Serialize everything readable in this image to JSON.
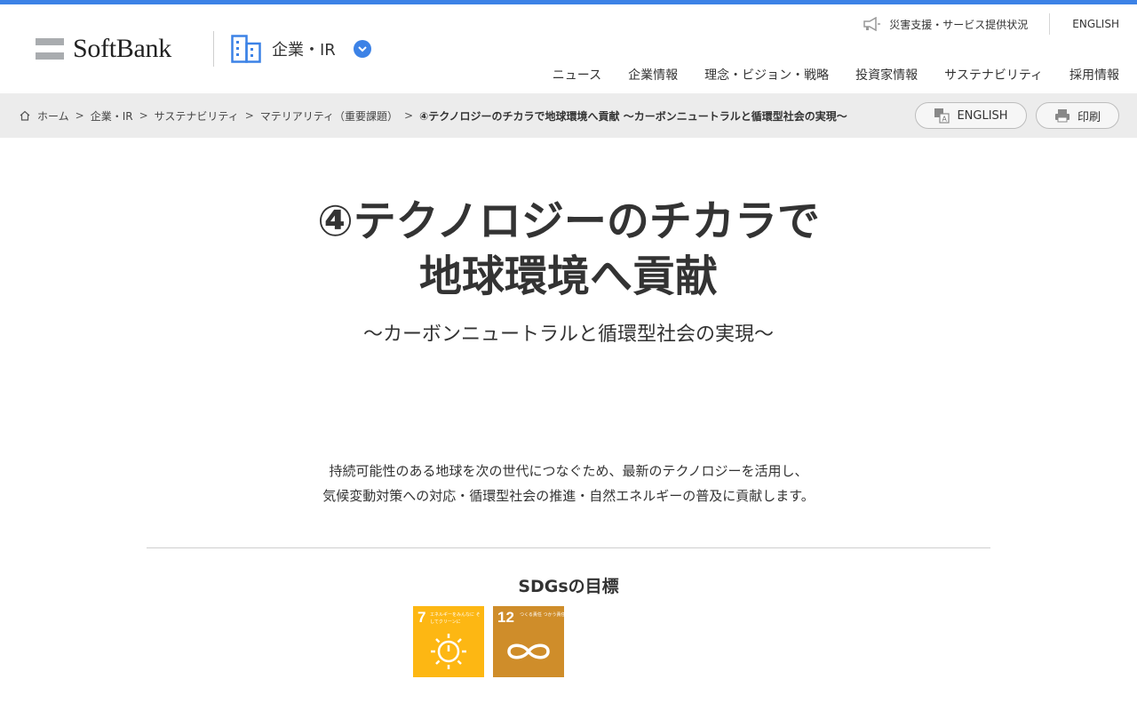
{
  "header": {
    "logo_text": "SoftBank",
    "section_label": "企業・IR",
    "utility_links": {
      "disaster": "災害支援・サービス提供状況",
      "english": "ENGLISH"
    },
    "gnav": [
      "ニュース",
      "企業情報",
      "理念・ビジョン・戦略",
      "投資家情報",
      "サステナビリティ",
      "採用情報"
    ]
  },
  "breadcrumb": {
    "items": [
      "ホーム",
      "企業・IR",
      "サステナビリティ",
      "マテリアリティ（重要課題）"
    ],
    "current": "④テクノロジーのチカラで地球環境へ貢献 〜カーボンニュートラルと循環型社会の実現〜"
  },
  "actions": {
    "english": "ENGLISH",
    "print": "印刷"
  },
  "main": {
    "title_line1": "④テクノロジーのチカラで",
    "title_line2": "地球環境へ貢献",
    "subtitle": "〜カーボンニュートラルと循環型社会の実現〜",
    "lead_line1": "持続可能性のある地球を次の世代につなぐため、最新のテクノロジーを活用し、",
    "lead_line2": "気候変動対策への対応・循環型社会の推進・自然エネルギーの普及に貢献します。"
  },
  "sdgs": {
    "heading": "SDGsの目標",
    "goals": [
      {
        "number": "7",
        "caption": "エネルギーをみんなに そしてクリーンに",
        "color": "#fdb713",
        "icon": "sun-power-icon"
      },
      {
        "number": "12",
        "caption": "つくる責任 つかう責任",
        "color": "#cf8d2a",
        "icon": "infinity-icon"
      }
    ]
  },
  "colors": {
    "accent": "#3c82e6",
    "band": "#ececec"
  }
}
